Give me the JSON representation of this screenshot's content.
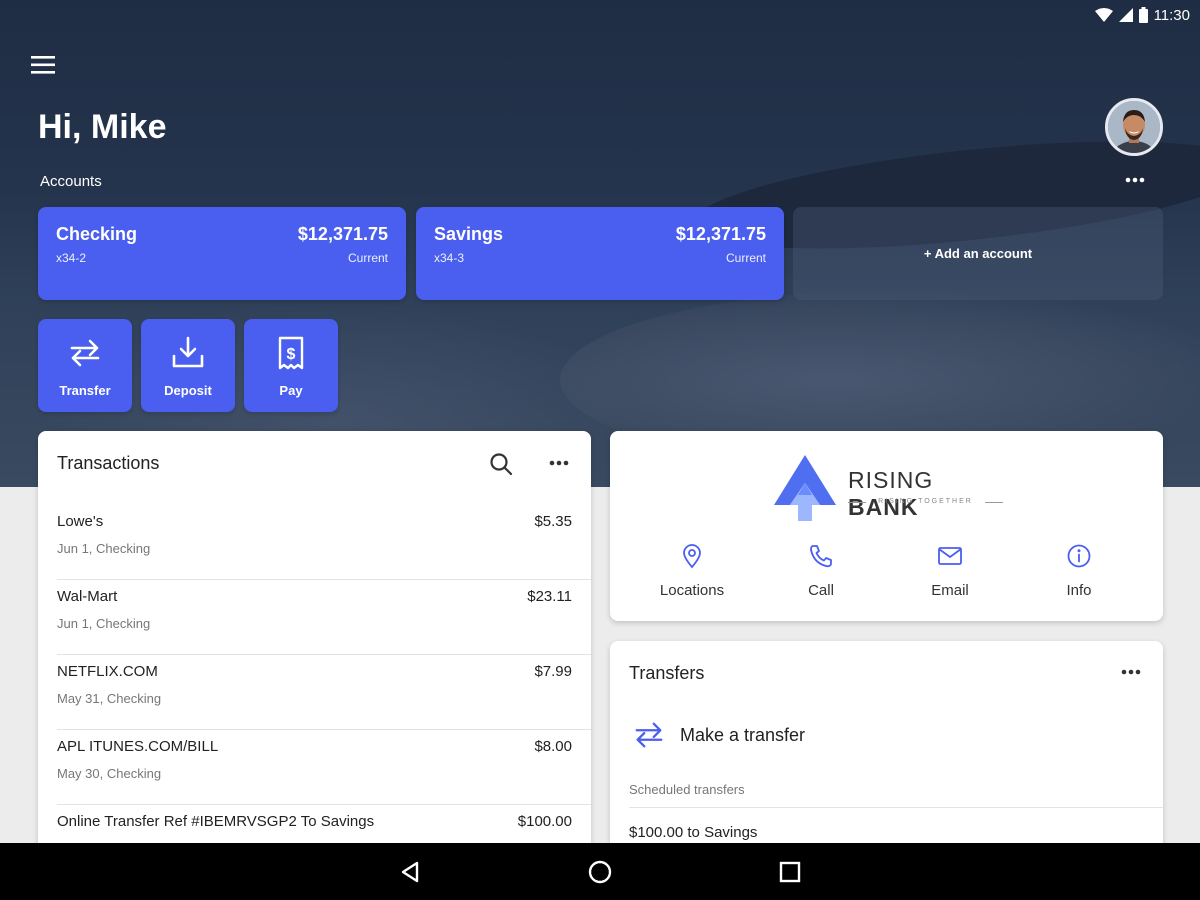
{
  "status_bar": {
    "time": "11:30"
  },
  "header": {
    "greeting": "Hi, Mike",
    "accounts_label": "Accounts"
  },
  "accounts": [
    {
      "name": "Checking",
      "number": "x34-2",
      "balance": "$12,371.75",
      "balance_label": "Current"
    },
    {
      "name": "Savings",
      "number": "x34-3",
      "balance": "$12,371.75",
      "balance_label": "Current"
    }
  ],
  "add_account_label": "+ Add an account",
  "quick_actions": [
    {
      "label": "Transfer",
      "icon": "transfer-icon"
    },
    {
      "label": "Deposit",
      "icon": "deposit-icon"
    },
    {
      "label": "Pay",
      "icon": "pay-icon"
    }
  ],
  "transactions": {
    "title": "Transactions",
    "items": [
      {
        "merchant": "Lowe's",
        "meta": "Jun 1, Checking",
        "amount": "$5.35"
      },
      {
        "merchant": "Wal-Mart",
        "meta": "Jun 1, Checking",
        "amount": "$23.11"
      },
      {
        "merchant": "NETFLIX.COM",
        "meta": "May 31, Checking",
        "amount": "$7.99"
      },
      {
        "merchant": "APL ITUNES.COM/BILL",
        "meta": "May 30, Checking",
        "amount": "$8.00"
      },
      {
        "merchant": "Online Transfer Ref #IBEMRVSGP2 To Savings",
        "meta": "",
        "amount": "$100.00"
      }
    ]
  },
  "bank": {
    "name_part1": "RISING ",
    "name_part2": "BANK",
    "tagline": "RISING TOGETHER",
    "contacts": [
      {
        "label": "Locations",
        "icon": "location-pin-icon"
      },
      {
        "label": "Call",
        "icon": "phone-icon"
      },
      {
        "label": "Email",
        "icon": "email-icon"
      },
      {
        "label": "Info",
        "icon": "info-icon"
      }
    ]
  },
  "transfers": {
    "title": "Transfers",
    "make_transfer_label": "Make a transfer",
    "scheduled_label": "Scheduled transfers",
    "scheduled_items": [
      "$100.00 to Savings"
    ]
  },
  "colors": {
    "accent": "#4a5ff0",
    "hero": "#24344c",
    "background": "#ececec"
  }
}
